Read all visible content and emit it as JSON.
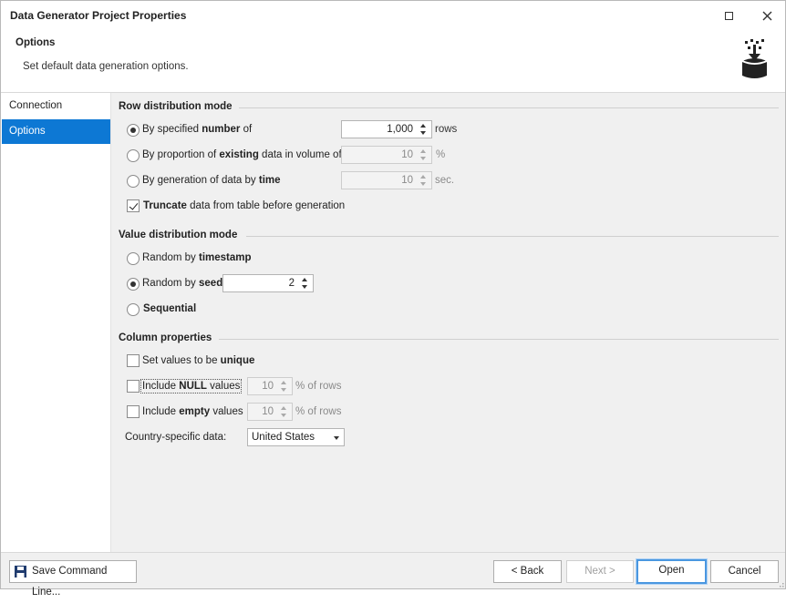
{
  "window": {
    "title": "Data Generator Project Properties"
  },
  "header": {
    "title": "Options",
    "description": "Set default data generation options.",
    "icon": "data-generator-icon"
  },
  "sidebar": {
    "items": [
      {
        "label": "Connection",
        "active": false
      },
      {
        "label": "Options",
        "active": true
      }
    ]
  },
  "row_distribution": {
    "title": "Row distribution mode",
    "by_number": {
      "prefix": "By specified ",
      "bold": "number",
      "suffix": " of",
      "value": "1,000",
      "unit": "rows",
      "selected": true
    },
    "by_proportion": {
      "prefix": "By proportion of ",
      "bold": "existing",
      "suffix": " data in volume of",
      "value": "10",
      "unit": "%",
      "selected": false
    },
    "by_time": {
      "prefix": "By generation of data by ",
      "bold": "time",
      "suffix": "",
      "value": "10",
      "unit": "sec.",
      "selected": false
    },
    "truncate": {
      "bold": "Truncate",
      "suffix": " data from table before generation",
      "checked": true
    }
  },
  "value_distribution": {
    "title": "Value distribution mode",
    "timestamp": {
      "prefix": "Random by ",
      "bold": "timestamp",
      "selected": false
    },
    "seed": {
      "prefix": "Random by ",
      "bold": "seed",
      "value": "2",
      "selected": true
    },
    "sequential": {
      "bold": "Sequential",
      "selected": false
    }
  },
  "column_properties": {
    "title": "Column properties",
    "unique": {
      "prefix": "Set values to be ",
      "bold": "unique",
      "checked": false
    },
    "null_values": {
      "prefix": "Include ",
      "bold": "NULL",
      "suffix": " values",
      "value": "10",
      "unit": "% of rows",
      "checked": false
    },
    "empty_values": {
      "prefix": "Include ",
      "bold": "empty",
      "suffix": " values",
      "value": "10",
      "unit": "% of rows",
      "checked": false
    },
    "country": {
      "label": "Country-specific data:",
      "value": "United States"
    }
  },
  "footer": {
    "save_command_line": "Save Command Line...",
    "back": "< Back",
    "next": "Next >",
    "open": "Open",
    "cancel": "Cancel"
  },
  "colors": {
    "accent": "#0d78d4",
    "panel": "#f0f0f0"
  }
}
